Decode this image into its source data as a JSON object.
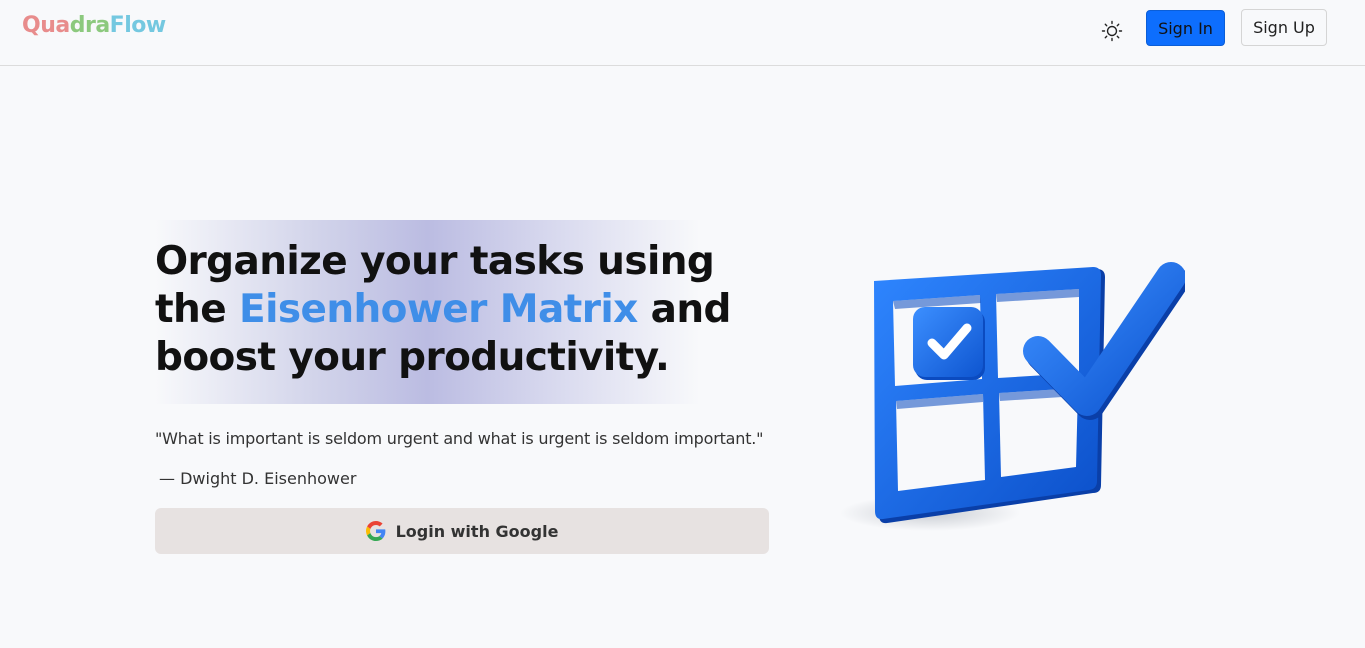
{
  "header": {
    "logo": [
      {
        "text": "Qua",
        "color": "#e88c8c"
      },
      {
        "text": "dra",
        "color": "#8cc97e"
      },
      {
        "text": "Flow",
        "color": "#74c8e0"
      }
    ],
    "theme_icon": "sun-icon",
    "signin_label": "Sign In",
    "signup_label": "Sign Up"
  },
  "hero": {
    "headline_pre": "Organize your tasks using the ",
    "headline_accent": "Eisenhower Matrix",
    "headline_post": " and boost your productivity.",
    "accent_color": "#3f8ee8",
    "quote": "\"What is important is seldom urgent and what is urgent is seldom important.\"",
    "author": "— Dwight D. Eisenhower",
    "google_button_label": "Login with Google",
    "google_icon": "google-g-icon",
    "illustration": "matrix-checkmark-icon"
  },
  "colors": {
    "primary": "#0d6efd",
    "illustration_blue": "#1565e0"
  }
}
